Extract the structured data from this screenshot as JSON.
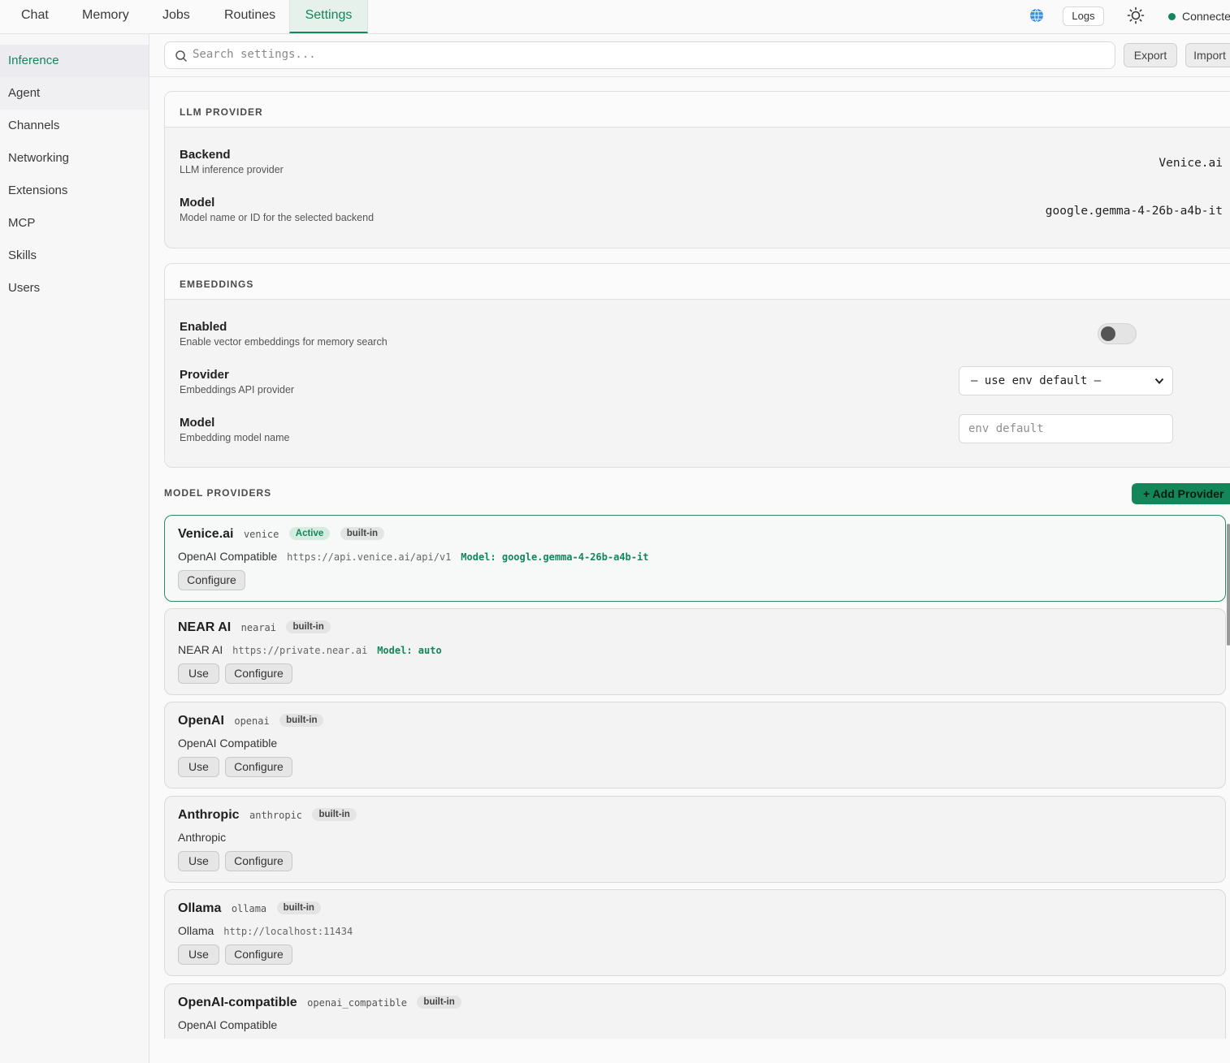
{
  "nav": {
    "tabs": [
      {
        "label": "Chat"
      },
      {
        "label": "Memory"
      },
      {
        "label": "Jobs"
      },
      {
        "label": "Routines"
      },
      {
        "label": "Settings"
      }
    ],
    "logs_label": "Logs",
    "status_text": "Connected",
    "icons": {
      "language": "globe-icon",
      "theme": "sun-icon"
    }
  },
  "sidebar": {
    "items": [
      {
        "label": "Inference"
      },
      {
        "label": "Agent"
      },
      {
        "label": "Channels"
      },
      {
        "label": "Networking"
      },
      {
        "label": "Extensions"
      },
      {
        "label": "MCP"
      },
      {
        "label": "Skills"
      },
      {
        "label": "Users"
      }
    ]
  },
  "toolbar": {
    "search_placeholder": "Search settings...",
    "export_label": "Export",
    "import_label": "Import"
  },
  "llm": {
    "title": "LLM PROVIDER",
    "backend_label": "Backend",
    "backend_desc": "LLM inference provider",
    "backend_value": "Venice.ai",
    "model_label": "Model",
    "model_desc": "Model name or ID for the selected backend",
    "model_value": "google.gemma-4-26b-a4b-it"
  },
  "embeddings": {
    "title": "EMBEDDINGS",
    "enabled_label": "Enabled",
    "enabled_desc": "Enable vector embeddings for memory search",
    "enabled": false,
    "provider_label": "Provider",
    "provider_desc": "Embeddings API provider",
    "provider_value": "— use env default —",
    "model_label": "Model",
    "model_desc": "Embedding model name",
    "model_placeholder": "env default"
  },
  "model_providers": {
    "title": "MODEL PROVIDERS",
    "add_label": "+ Add Provider",
    "use_label": "Use",
    "configure_label": "Configure",
    "active_badge": "Active",
    "builtin_badge": "built-in",
    "providers": [
      {
        "name": "Venice.ai",
        "id": "venice",
        "type": "OpenAI Compatible",
        "url": "https://api.venice.ai/api/v1",
        "model": "Model: google.gemma-4-26b-a4b-it"
      },
      {
        "name": "NEAR AI",
        "id": "nearai",
        "type": "NEAR AI",
        "url": "https://private.near.ai",
        "model": "Model: auto"
      },
      {
        "name": "OpenAI",
        "id": "openai",
        "type": "OpenAI Compatible"
      },
      {
        "name": "Anthropic",
        "id": "anthropic",
        "type": "Anthropic"
      },
      {
        "name": "Ollama",
        "id": "ollama",
        "type": "Ollama",
        "url": "http://localhost:11434"
      },
      {
        "name": "OpenAI-compatible",
        "id": "openai_compatible",
        "type": "OpenAI Compatible"
      }
    ]
  },
  "colors": {
    "accent": "#13875a"
  }
}
